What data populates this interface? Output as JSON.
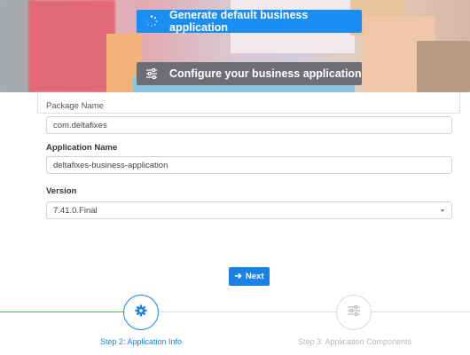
{
  "hero": {
    "generate_label": "Generate default business application",
    "configure_label": "Configure your business application",
    "icons": {
      "generate": "spinner-icon",
      "configure": "sliders-icon"
    }
  },
  "form": {
    "package_name": {
      "label": "Package Name",
      "value": "com.deltafixes"
    },
    "application_name": {
      "label": "Application Name",
      "value": "deltafixes-business-application"
    },
    "version": {
      "label": "Version",
      "selected": "7.41.0.Final"
    }
  },
  "actions": {
    "next_label": "Next",
    "next_icon": "arrow-right-icon"
  },
  "stepper": {
    "steps": [
      {
        "label": "Step 2: Application Info",
        "icon": "gear-icon",
        "state": "active"
      },
      {
        "label": "Step 3: Application Components",
        "icon": "sliders-icon",
        "state": "inactive"
      }
    ]
  },
  "colors": {
    "primary": "#1a82e6",
    "secondary": "#6d6f74",
    "progress": "#5cb85c",
    "inactive": "#b8b8b8"
  }
}
